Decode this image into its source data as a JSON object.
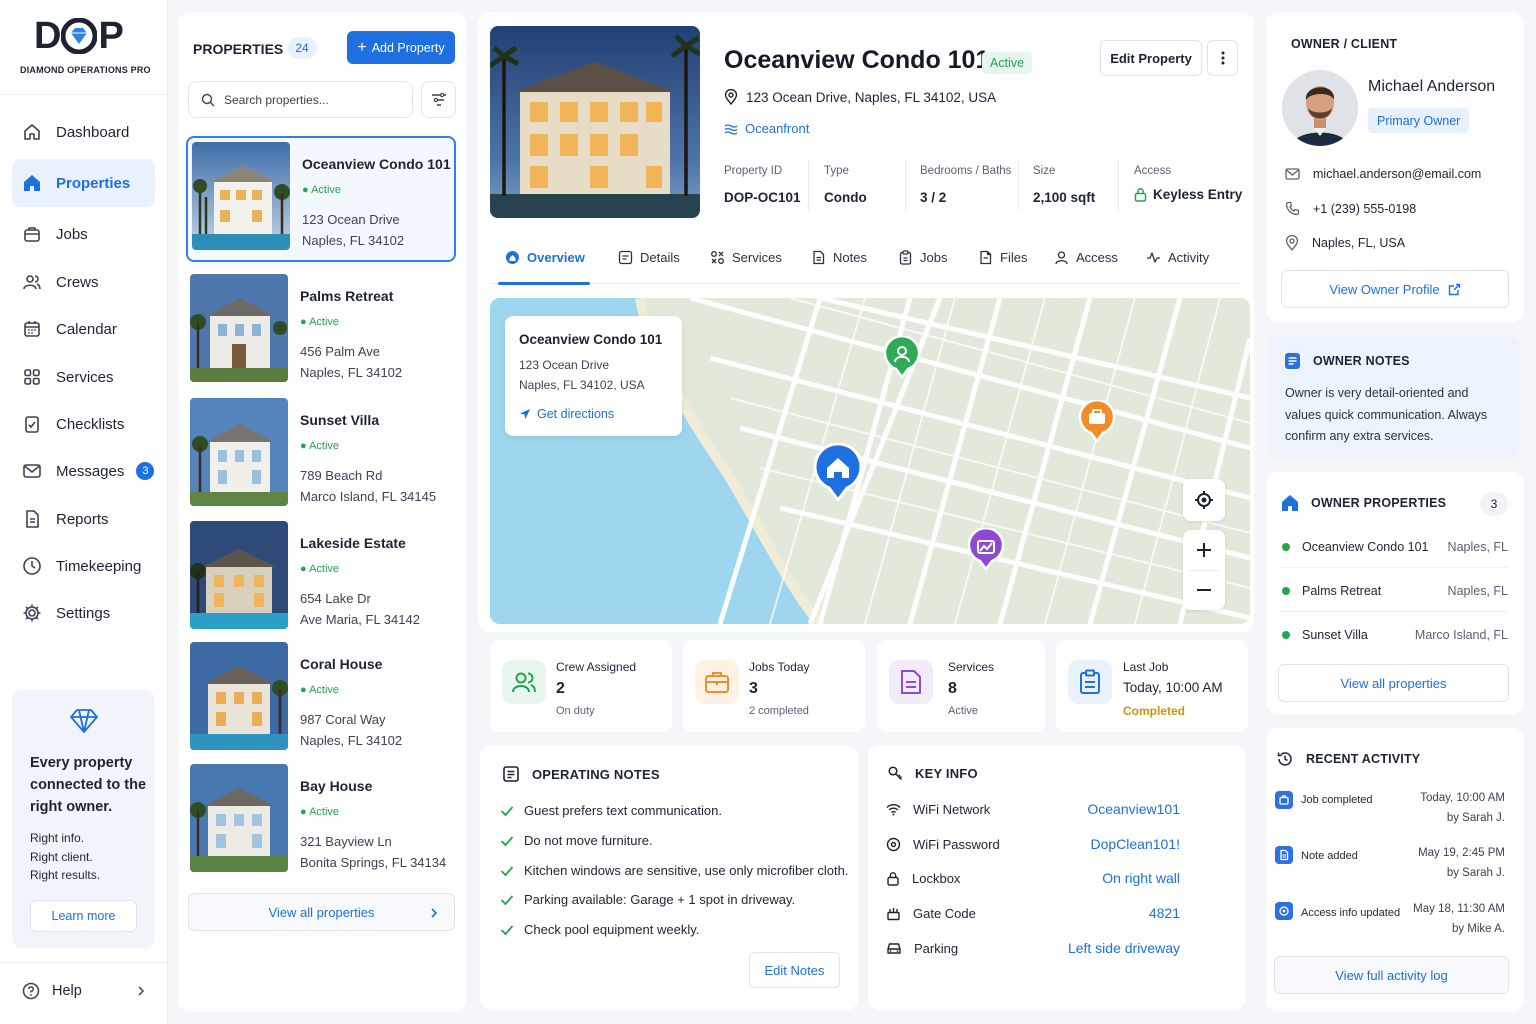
{
  "brand": {
    "logo": "DOP",
    "name": "DIAMOND OPERATIONS PRO"
  },
  "nav": [
    {
      "label": "Dashboard",
      "icon": "home-icon"
    },
    {
      "label": "Properties",
      "icon": "house-filled-icon",
      "active": true
    },
    {
      "label": "Jobs",
      "icon": "briefcase-icon"
    },
    {
      "label": "Crews",
      "icon": "users-icon"
    },
    {
      "label": "Calendar",
      "icon": "calendar-icon"
    },
    {
      "label": "Services",
      "icon": "grid-icon"
    },
    {
      "label": "Checklists",
      "icon": "checklist-icon"
    },
    {
      "label": "Messages",
      "icon": "mail-icon",
      "badge": "3"
    },
    {
      "label": "Reports",
      "icon": "report-icon"
    },
    {
      "label": "Timekeeping",
      "icon": "clock-icon"
    },
    {
      "label": "Settings",
      "icon": "gear-icon"
    }
  ],
  "promo": {
    "title": "Every property connected to the right owner.",
    "lines": [
      "Right info.",
      "Right client.",
      "Right results."
    ],
    "button": "Learn more"
  },
  "help": "Help",
  "list": {
    "title": "PROPERTIES",
    "count": "24",
    "add": "Add Property",
    "search_placeholder": "Search properties...",
    "view_all": "View all properties",
    "items": [
      {
        "name": "Oceanview Condo 101",
        "status": "Active",
        "addr1": "123 Ocean Drive",
        "addr2": "Naples, FL 34102"
      },
      {
        "name": "Palms Retreat",
        "status": "Active",
        "addr1": "456 Palm Ave",
        "addr2": "Naples, FL 34102"
      },
      {
        "name": "Sunset Villa",
        "status": "Active",
        "addr1": "789 Beach Rd",
        "addr2": "Marco Island, FL 34145"
      },
      {
        "name": "Lakeside Estate",
        "status": "Active",
        "addr1": "654 Lake Dr",
        "addr2": "Ave Maria, FL 34142"
      },
      {
        "name": "Coral House",
        "status": "Active",
        "addr1": "987 Coral Way",
        "addr2": "Naples, FL 34102"
      },
      {
        "name": "Bay House",
        "status": "Active",
        "addr1": "321 Bayview Ln",
        "addr2": "Bonita Springs, FL 34134"
      }
    ]
  },
  "detail": {
    "name": "Oceanview Condo 101",
    "status": "Active",
    "edit": "Edit Property",
    "address": "123 Ocean Drive, Naples, FL 34102, USA",
    "tag": "Oceanfront",
    "facts": [
      {
        "label": "Property ID",
        "value": "DOP-OC101"
      },
      {
        "label": "Type",
        "value": "Condo"
      },
      {
        "label": "Bedrooms / Baths",
        "value": "3 / 2"
      },
      {
        "label": "Size",
        "value": "2,100 sqft"
      },
      {
        "label": "Access",
        "value": "Keyless Entry"
      }
    ],
    "tabs": [
      "Overview",
      "Details",
      "Services",
      "Notes",
      "Jobs",
      "Files",
      "Access",
      "Activity"
    ]
  },
  "map": {
    "title": "Oceanview Condo 101",
    "addr1": "123 Ocean Drive",
    "addr2": "Naples, FL 34102, USA",
    "directions": "Get directions"
  },
  "stats": [
    {
      "label": "Crew Assigned",
      "value": "2",
      "sub": "On duty"
    },
    {
      "label": "Jobs Today",
      "value": "3",
      "sub": "2 completed"
    },
    {
      "label": "Services",
      "value": "8",
      "sub": "Active"
    },
    {
      "label": "Last Job",
      "value": "Today, 10:00 AM",
      "sub": "Completed"
    }
  ],
  "operating_notes": {
    "title": "OPERATING NOTES",
    "items": [
      "Guest prefers text communication.",
      "Do not move furniture.",
      "Kitchen windows are sensitive, use only microfiber cloth.",
      "Parking available: Garage + 1 spot in driveway.",
      "Check pool equipment weekly."
    ],
    "button": "Edit Notes"
  },
  "key_info": {
    "title": "KEY INFO",
    "items": [
      {
        "label": "WiFi Network",
        "value": "Oceanview101"
      },
      {
        "label": "WiFi Password",
        "value": "DopClean101!"
      },
      {
        "label": "Lockbox",
        "value": "On right wall"
      },
      {
        "label": "Gate Code",
        "value": "4821"
      },
      {
        "label": "Parking",
        "value": "Left side driveway"
      }
    ]
  },
  "owner": {
    "section": "OWNER / CLIENT",
    "name": "Michael Anderson",
    "role": "Primary Owner",
    "email": "michael.anderson@email.com",
    "phone": "+1 (239) 555-0198",
    "location": "Naples, FL, USA",
    "profile_button": "View Owner Profile"
  },
  "owner_notes": {
    "title": "OWNER NOTES",
    "text": "Owner is very detail-oriented and values quick communication. Always confirm any extra services."
  },
  "owner_properties": {
    "title": "OWNER PROPERTIES",
    "count": "3",
    "items": [
      {
        "name": "Oceanview Condo 101",
        "city": "Naples, FL"
      },
      {
        "name": "Palms Retreat",
        "city": "Naples, FL"
      },
      {
        "name": "Sunset Villa",
        "city": "Marco Island, FL"
      }
    ],
    "button": "View all properties"
  },
  "recent_activity": {
    "title": "RECENT ACTIVITY",
    "items": [
      {
        "text": "Job completed",
        "time": "Today, 10:00 AM",
        "by": "by Sarah J."
      },
      {
        "text": "Note added",
        "time": "May 19, 2:45 PM",
        "by": "by Sarah J."
      },
      {
        "text": "Access info updated",
        "time": "May 18, 11:30 AM",
        "by": "by Mike A."
      }
    ],
    "button": "View full activity log"
  },
  "colors": {
    "accent": "#1e6fe0",
    "active": "#22a54f",
    "completed": "#c8960c"
  }
}
